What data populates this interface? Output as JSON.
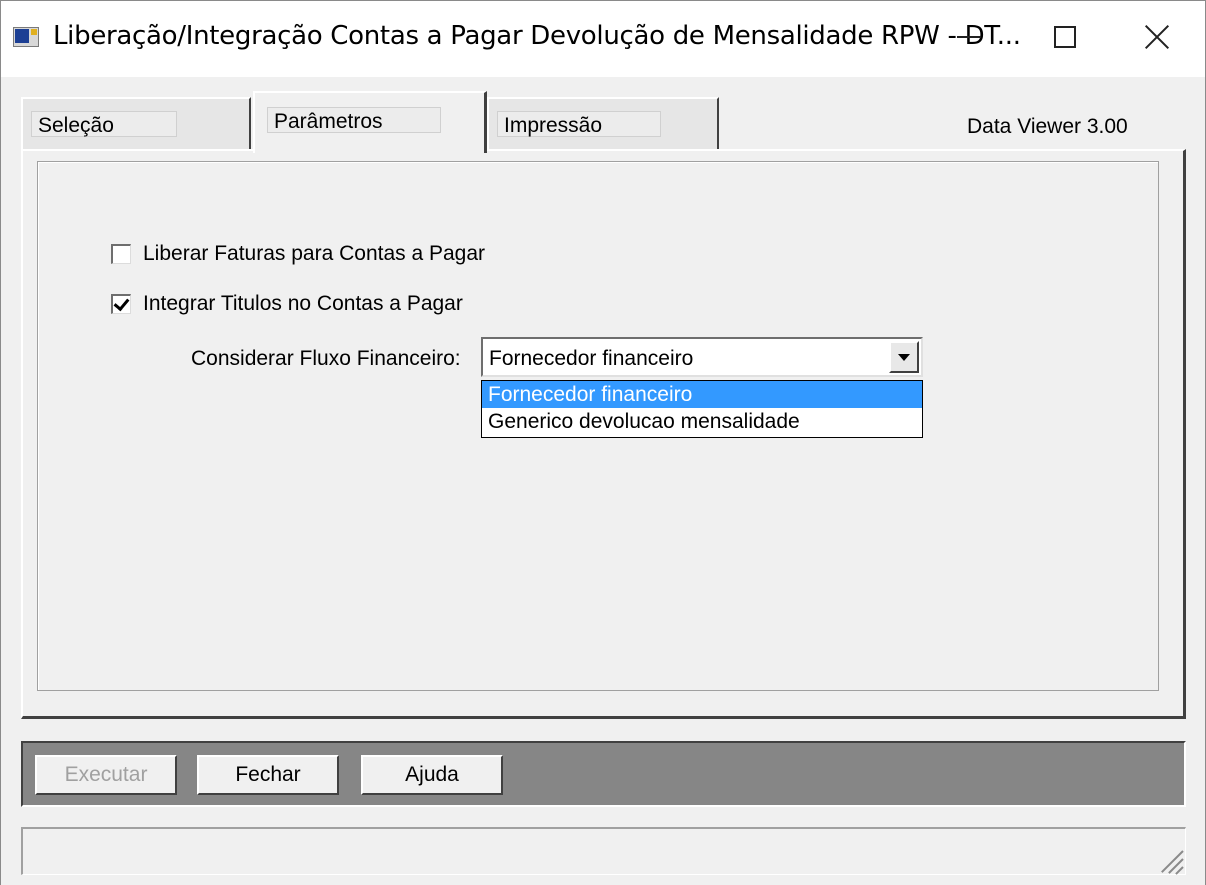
{
  "window": {
    "title": "Liberação/Integração Contas a Pagar Devolução de Mensalidade RPW - DT...",
    "controls": [
      "minimize",
      "maximize",
      "close"
    ]
  },
  "tabs": [
    {
      "label": "Seleção",
      "active": false
    },
    {
      "label": "Parâmetros",
      "active": true
    },
    {
      "label": "Impressão",
      "active": false
    }
  ],
  "viewer_label": "Data Viewer 3.00",
  "form": {
    "liberar_faturas": {
      "label": "Liberar Faturas para Contas a Pagar",
      "checked": false
    },
    "integrar_titulos": {
      "label": "Integrar Titulos no Contas a Pagar",
      "checked": true
    },
    "fluxo_financeiro": {
      "label": "Considerar Fluxo Financeiro:",
      "value": "Fornecedor financeiro",
      "options": [
        "Fornecedor financeiro",
        "Generico devolucao mensalidade"
      ],
      "expanded": true
    }
  },
  "buttons": {
    "executar": {
      "label": "Executar",
      "enabled": false
    },
    "fechar": {
      "label": "Fechar",
      "enabled": true
    },
    "ajuda": {
      "label": "Ajuda",
      "enabled": true
    }
  },
  "colors": {
    "highlight": "#3399ff",
    "button_bar": "#868686",
    "face": "#f0f0f0"
  }
}
